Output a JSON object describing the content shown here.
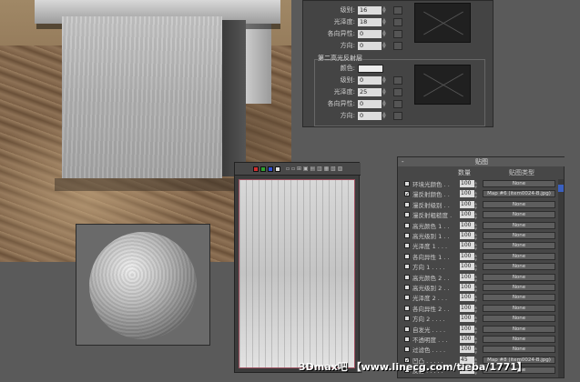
{
  "params": {
    "rows_top": [
      {
        "label": "级别:",
        "value": "16"
      },
      {
        "label": "光泽度:",
        "value": "18"
      },
      {
        "label": "各向异性:",
        "value": "0"
      },
      {
        "label": "方向:",
        "value": "0"
      }
    ],
    "group_title": "第二高光反射层",
    "color_label": "颜色:",
    "rows_group": [
      {
        "label": "级别:",
        "value": "0"
      },
      {
        "label": "光泽度:",
        "value": "25"
      },
      {
        "label": "各向异性:",
        "value": "0"
      },
      {
        "label": "方向:",
        "value": "0"
      }
    ]
  },
  "bitmap": {
    "swatches": [
      "#d03030",
      "#30a030",
      "#3050d0",
      "#e0e0e0"
    ],
    "tools": "▫ ▫ ⊞ ▣ ▤ ▥ ▦ ▧ ▨"
  },
  "maps": {
    "pm": "-",
    "title": "贴图",
    "head_amount": "数量",
    "head_type": "贴图类型",
    "rows": [
      {
        "name": "环境光颜色 . .",
        "amount": "100",
        "map": "None",
        "checked": false
      },
      {
        "name": "漫反射颜色 . .",
        "amount": "100",
        "map": "Map #6 (item0024-B.jpg)",
        "checked": true
      },
      {
        "name": "漫反射级别 . .",
        "amount": "100",
        "map": "None",
        "checked": false
      },
      {
        "name": "漫反射粗糙度 .",
        "amount": "100",
        "map": "None",
        "checked": false
      },
      {
        "name": "高光颜色 1 . .",
        "amount": "100",
        "map": "None",
        "checked": false
      },
      {
        "name": "高光级别 1 . .",
        "amount": "100",
        "map": "None",
        "checked": false
      },
      {
        "name": "光泽度 1 . . .",
        "amount": "100",
        "map": "None",
        "checked": false
      },
      {
        "name": "各向异性 1 . .",
        "amount": "100",
        "map": "None",
        "checked": false
      },
      {
        "name": "方向 1 . . . .",
        "amount": "100",
        "map": "None",
        "checked": false
      },
      {
        "name": "高光颜色 2 . .",
        "amount": "100",
        "map": "None",
        "checked": false
      },
      {
        "name": "高光级别 2 . .",
        "amount": "100",
        "map": "None",
        "checked": false
      },
      {
        "name": "光泽度 2 . . .",
        "amount": "100",
        "map": "None",
        "checked": false
      },
      {
        "name": "各向异性 2 . .",
        "amount": "100",
        "map": "None",
        "checked": false
      },
      {
        "name": "方向 2 . . . .",
        "amount": "100",
        "map": "None",
        "checked": false
      },
      {
        "name": "自发光 . . . .",
        "amount": "100",
        "map": "None",
        "checked": false
      },
      {
        "name": "不透明度 . . .",
        "amount": "100",
        "map": "None",
        "checked": false
      },
      {
        "name": "过滤色 . . . .",
        "amount": "100",
        "map": "None",
        "checked": false
      },
      {
        "name": "凹凸 . . . . .",
        "amount": "45",
        "map": "Map #8 (item0024-B.jpg)",
        "checked": true
      },
      {
        "name": "反射 . . . . .",
        "amount": "100",
        "map": "None",
        "checked": false
      }
    ]
  },
  "watermark": "3Dmax吧 【www.linecg.com/tieba/1771】"
}
